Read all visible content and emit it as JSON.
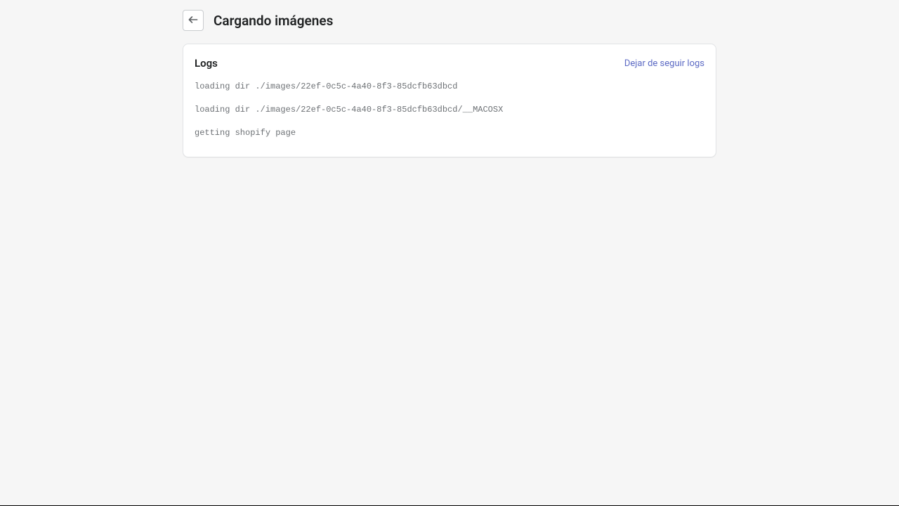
{
  "header": {
    "title": "Cargando imágenes"
  },
  "card": {
    "title": "Logs",
    "action_label": "Dejar de seguir logs",
    "logs": [
      "loading dir ./images/22ef-0c5c-4a40-8f3-85dcfb63dbcd",
      "loading dir ./images/22ef-0c5c-4a40-8f3-85dcfb63dbcd/__MACOSX",
      "getting shopify page"
    ]
  }
}
